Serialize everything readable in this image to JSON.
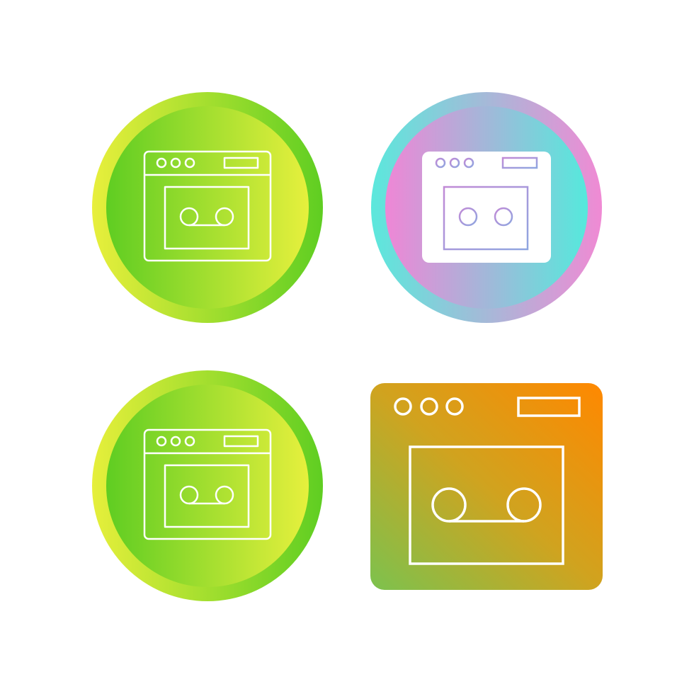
{
  "icon_set": {
    "subject": "voicemail-browser-window-icon",
    "variants": [
      {
        "style": "line-on-circle",
        "icon": "browser-voicemail-icon",
        "colors": {
          "outer_from": "#5fce22",
          "outer_to": "#e4ef3a",
          "inner_from": "#62cc24",
          "inner_to": "#e6f03d",
          "stroke": "#ffffff"
        }
      },
      {
        "style": "filled-on-circle",
        "icon": "browser-voicemail-icon",
        "colors": {
          "outer_from": "#f189d3",
          "outer_to": "#55e8dc",
          "inner_from": "#ef86d6",
          "inner_to": "#5be6df",
          "glyph_fill": "#ffffff",
          "glyph_stroke": "#a98cd8"
        }
      },
      {
        "style": "line-on-circle-reversed",
        "icon": "browser-voicemail-icon",
        "colors": {
          "outer_from": "#e4ef3a",
          "outer_to": "#5fce22",
          "inner_from": "#5fce22",
          "inner_to": "#e6f03d",
          "stroke": "#ffffff"
        }
      },
      {
        "style": "glyph-only",
        "icon": "browser-voicemail-icon",
        "colors": {
          "fill_from": "#78c24c",
          "fill_to": "#ff8a00",
          "stroke": "#ffffff"
        }
      }
    ]
  }
}
